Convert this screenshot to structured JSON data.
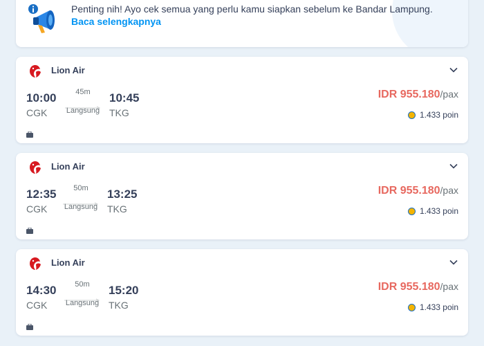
{
  "banner": {
    "text": "Penting nih! Ayo cek semua yang perlu kamu siapkan sebelum ke Bandar Lampung.",
    "link_label": "Baca selengkapnya",
    "icon": "megaphone-info-icon"
  },
  "colors": {
    "price": "#e7685f",
    "link": "#0194f3",
    "text": "#35405a",
    "muted": "#687176",
    "background": "#e9f1f8"
  },
  "flights": [
    {
      "airline": "Lion Air",
      "dep_time": "10:00",
      "dep_code": "CGK",
      "duration": "45m",
      "stops": "Langsung",
      "arr_time": "10:45",
      "arr_code": "TKG",
      "price": "IDR 955.180",
      "price_unit": "/pax",
      "points": "1.433 poin"
    },
    {
      "airline": "Lion Air",
      "dep_time": "12:35",
      "dep_code": "CGK",
      "duration": "50m",
      "stops": "Langsung",
      "arr_time": "13:25",
      "arr_code": "TKG",
      "price": "IDR 955.180",
      "price_unit": "/pax",
      "points": "1.433 poin"
    },
    {
      "airline": "Lion Air",
      "dep_time": "14:30",
      "dep_code": "CGK",
      "duration": "50m",
      "stops": "Langsung",
      "arr_time": "15:20",
      "arr_code": "TKG",
      "price": "IDR 955.180",
      "price_unit": "/pax",
      "points": "1.433 poin"
    }
  ]
}
